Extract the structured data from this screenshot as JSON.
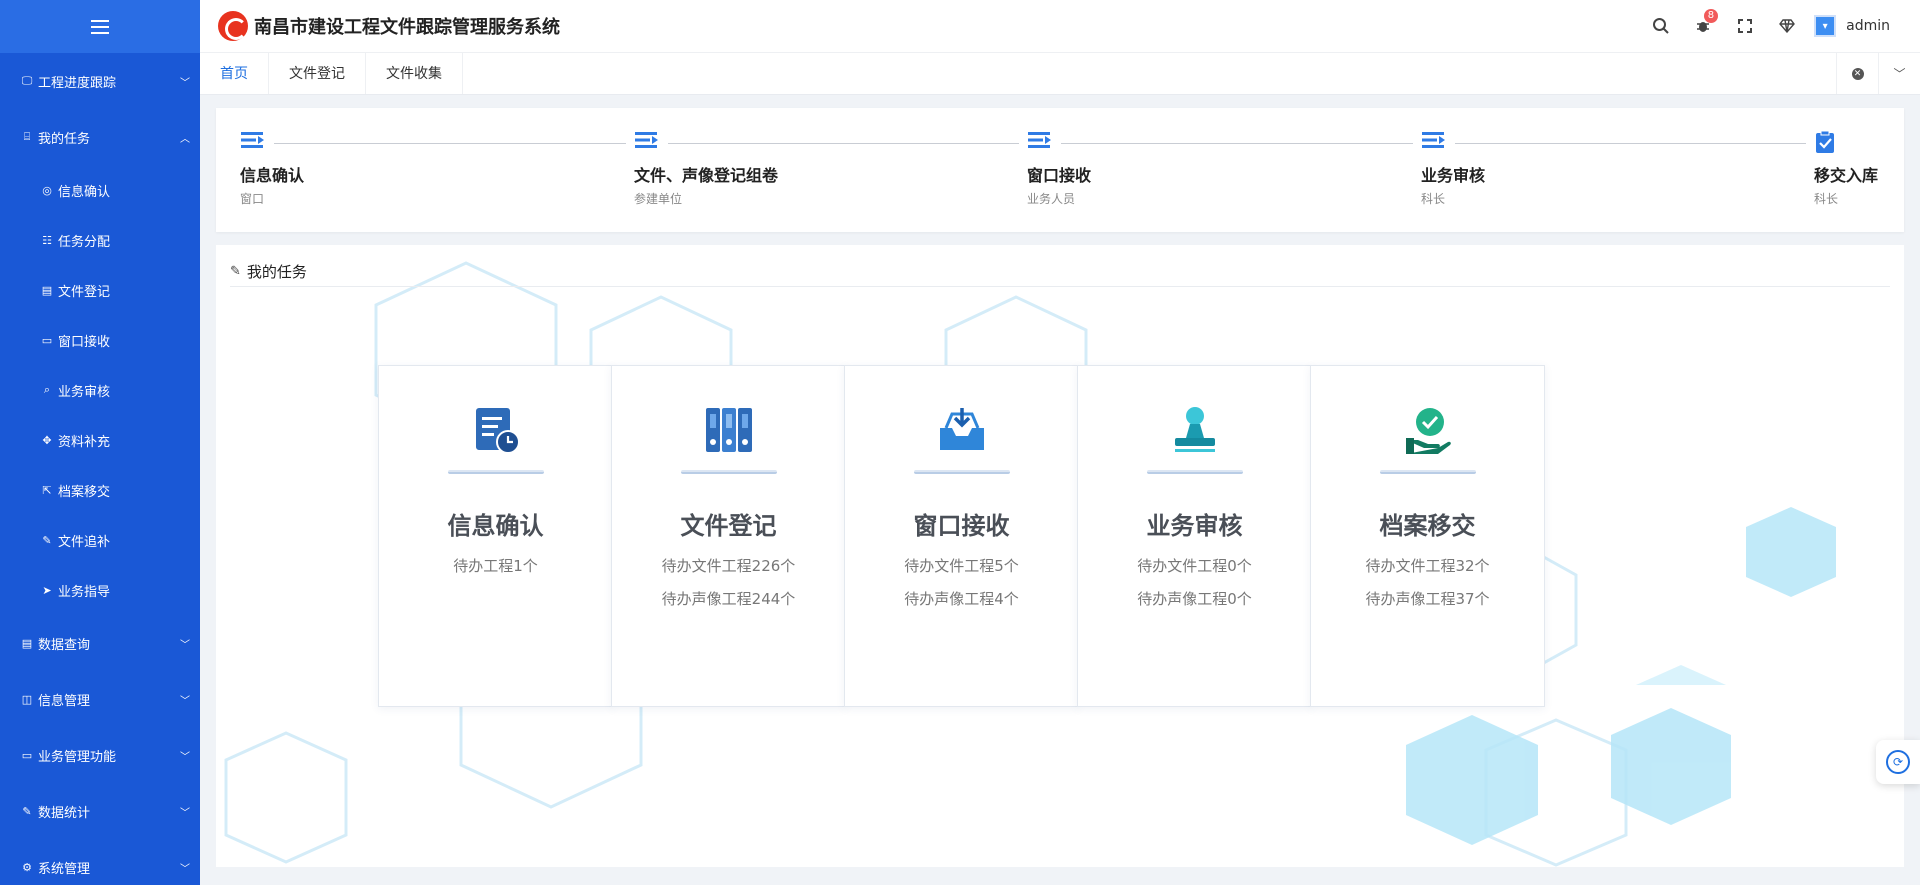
{
  "app": {
    "title": "南昌市建设工程文件跟踪管理服务系统",
    "username": "admin",
    "notification_count": "8"
  },
  "sidebar": {
    "groups_top": [
      {
        "label": "工程进度跟踪",
        "icon": "monitor-icon",
        "glyph": "🖵",
        "chevron": "﹀"
      }
    ],
    "task_group": {
      "label": "我的任务",
      "icon": "briefcase-icon",
      "glyph": "⌸",
      "chevron": "︿"
    },
    "task_items": [
      {
        "label": "信息确认",
        "icon": "info-confirm-icon",
        "glyph": "◎"
      },
      {
        "label": "任务分配",
        "icon": "list-icon",
        "glyph": "☷"
      },
      {
        "label": "文件登记",
        "icon": "file-icon",
        "glyph": "▤"
      },
      {
        "label": "窗口接收",
        "icon": "window-icon",
        "glyph": "▭"
      },
      {
        "label": "业务审核",
        "icon": "search-icon",
        "glyph": "⌕"
      },
      {
        "label": "资料补充",
        "icon": "move-icon",
        "glyph": "✥"
      },
      {
        "label": "档案移交",
        "icon": "external-link-icon",
        "glyph": "⇱"
      },
      {
        "label": "文件追补",
        "icon": "edit-icon",
        "glyph": "✎"
      },
      {
        "label": "业务指导",
        "icon": "send-icon",
        "glyph": "➤"
      }
    ],
    "groups_bottom": [
      {
        "label": "数据查询",
        "icon": "document-icon",
        "glyph": "▤",
        "chevron": "﹀"
      },
      {
        "label": "信息管理",
        "icon": "book-icon",
        "glyph": "◫",
        "chevron": "﹀"
      },
      {
        "label": "业务管理功能",
        "icon": "card-icon",
        "glyph": "▭",
        "chevron": "﹀"
      },
      {
        "label": "数据统计",
        "icon": "edit-icon",
        "glyph": "✎",
        "chevron": "﹀"
      },
      {
        "label": "系统管理",
        "icon": "gear-icon",
        "glyph": "⚙",
        "chevron": "﹀"
      }
    ]
  },
  "tabs": [
    {
      "label": "首页",
      "active": true
    },
    {
      "label": "文件登记",
      "active": false
    },
    {
      "label": "文件收集",
      "active": false
    }
  ],
  "steps": [
    {
      "title": "信息确认",
      "sub": "窗口",
      "icon": "flow-step-icon"
    },
    {
      "title": "文件、声像登记组卷",
      "sub": "参建单位",
      "icon": "flow-step-icon"
    },
    {
      "title": "窗口接收",
      "sub": "业务人员",
      "icon": "flow-step-icon"
    },
    {
      "title": "业务审核",
      "sub": "科长",
      "icon": "flow-step-icon"
    },
    {
      "title": "移交入库",
      "sub": "科长",
      "icon": "clipboard-check-icon"
    }
  ],
  "task_panel": {
    "title": "我的任务",
    "cards": [
      {
        "title": "信息确认",
        "line1": "待办工程1个",
        "line2": "",
        "icon": "document-clock-icon"
      },
      {
        "title": "文件登记",
        "line1": "待办文件工程226个",
        "line2": "待办声像工程244个",
        "icon": "binders-icon"
      },
      {
        "title": "窗口接收",
        "line1": "待办文件工程5个",
        "line2": "待办声像工程4个",
        "icon": "inbox-download-icon"
      },
      {
        "title": "业务审核",
        "line1": "待办文件工程0个",
        "line2": "待办声像工程0个",
        "icon": "stamp-icon"
      },
      {
        "title": "档案移交",
        "line1": "待办文件工程32个",
        "line2": "待办声像工程37个",
        "icon": "hand-check-icon"
      }
    ]
  },
  "colors": {
    "sidebar_bg": "#1a58d6",
    "accent": "#1e6fe0",
    "badge": "#f15a5a"
  }
}
